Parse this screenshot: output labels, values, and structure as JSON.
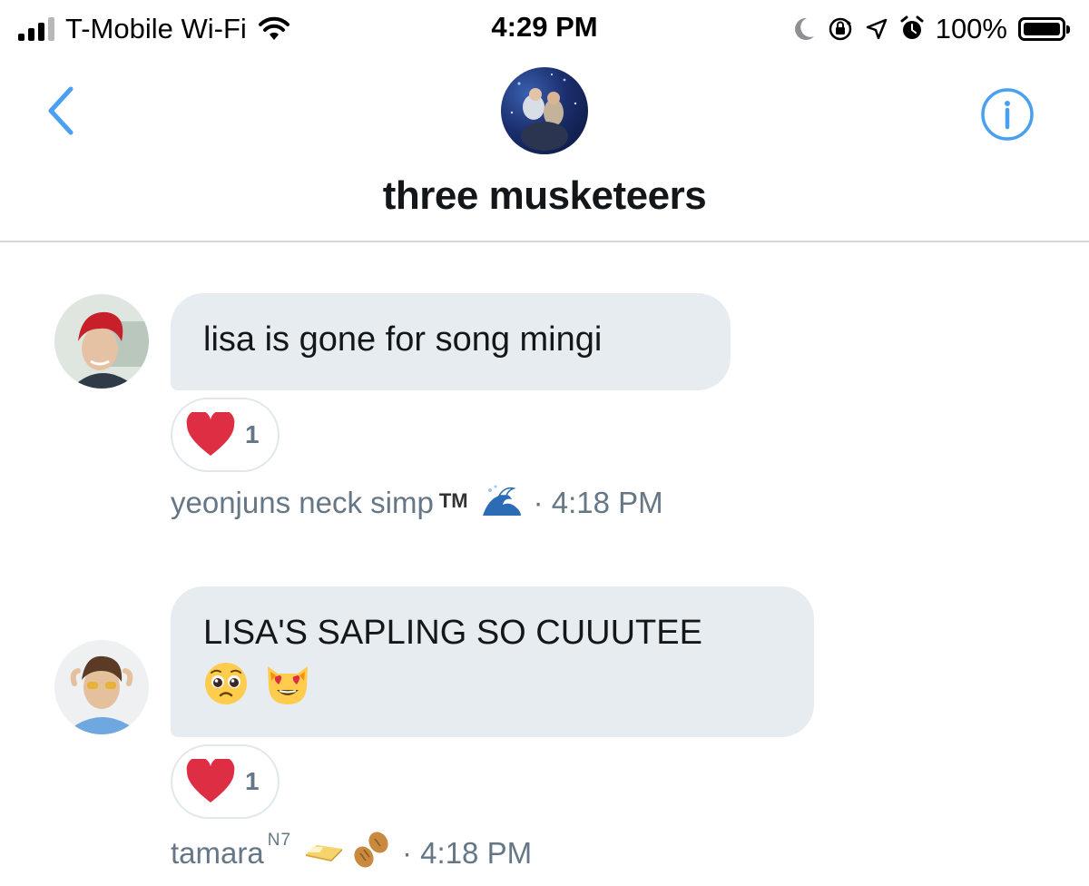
{
  "status_bar": {
    "carrier": "T-Mobile Wi-Fi",
    "time": "4:29 PM",
    "battery": "100%",
    "battery_level": 1.0,
    "signal_strength": 3,
    "icons": [
      "signal-icon",
      "wifi-icon",
      "do-not-disturb-icon",
      "orientation-lock-icon",
      "location-icon",
      "alarm-icon",
      "battery-icon"
    ]
  },
  "header": {
    "title": "three musketeers",
    "back_icon": "chevron-left-icon",
    "info_icon": "info-icon",
    "accent_color": "#4a9ff0"
  },
  "messages": [
    {
      "text": "lisa is gone for song mingi",
      "emojis": [],
      "reaction": {
        "icon": "heart-icon",
        "count": "1"
      },
      "sender": "yeonjuns neck simp",
      "sender_suffix": "TM",
      "sender_emojis": [
        "wave-icon"
      ],
      "time": "· 4:18 PM"
    },
    {
      "text": "LISA'S SAPLING SO CUUUTEE",
      "emojis": [
        "pleading-face-icon",
        "heart-eyes-cat-icon"
      ],
      "reaction": {
        "icon": "heart-icon",
        "count": "1"
      },
      "sender": "tamara",
      "sender_suffix": "N7",
      "sender_emojis": [
        "butter-icon",
        "peanut-icon"
      ],
      "time": "· 4:18 PM"
    }
  ],
  "colors": {
    "bubble": "#e6ecf0",
    "meta_text": "#657786",
    "heart": "#dd2e44",
    "divider": "#d4d8dc"
  }
}
